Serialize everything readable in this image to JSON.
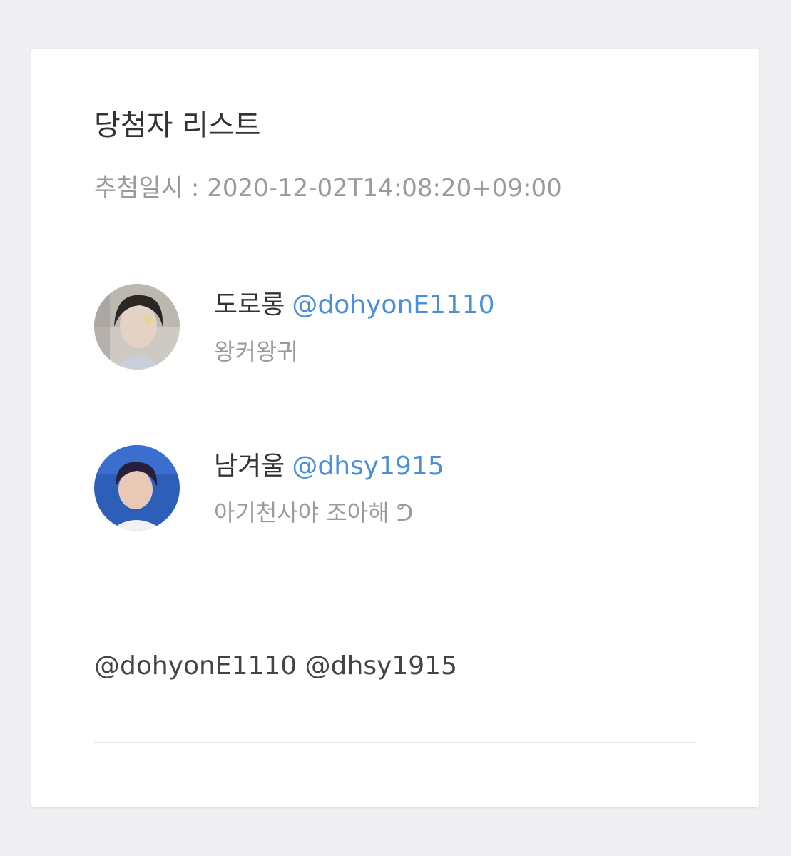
{
  "card": {
    "title": "당첨자 리스트",
    "draw_date": "추첨일시 : 2020-12-02T14:08:20+09:00"
  },
  "winners": [
    {
      "name": "도로롱",
      "handle": "@dohyonE1110",
      "comment": "왕커왕귀",
      "avatar": "profile-photo"
    },
    {
      "name": "남겨울",
      "handle": "@dhsy1915",
      "comment": "아기천사야 조아해 ᕤ",
      "avatar": "profile-photo"
    }
  ],
  "mentions": "@dohyonE1110 @dhsy1915",
  "colors": {
    "background": "#efeff1",
    "card": "#ffffff",
    "handle": "#4a90d9",
    "muted": "#9a9a9a",
    "text": "#333333"
  }
}
